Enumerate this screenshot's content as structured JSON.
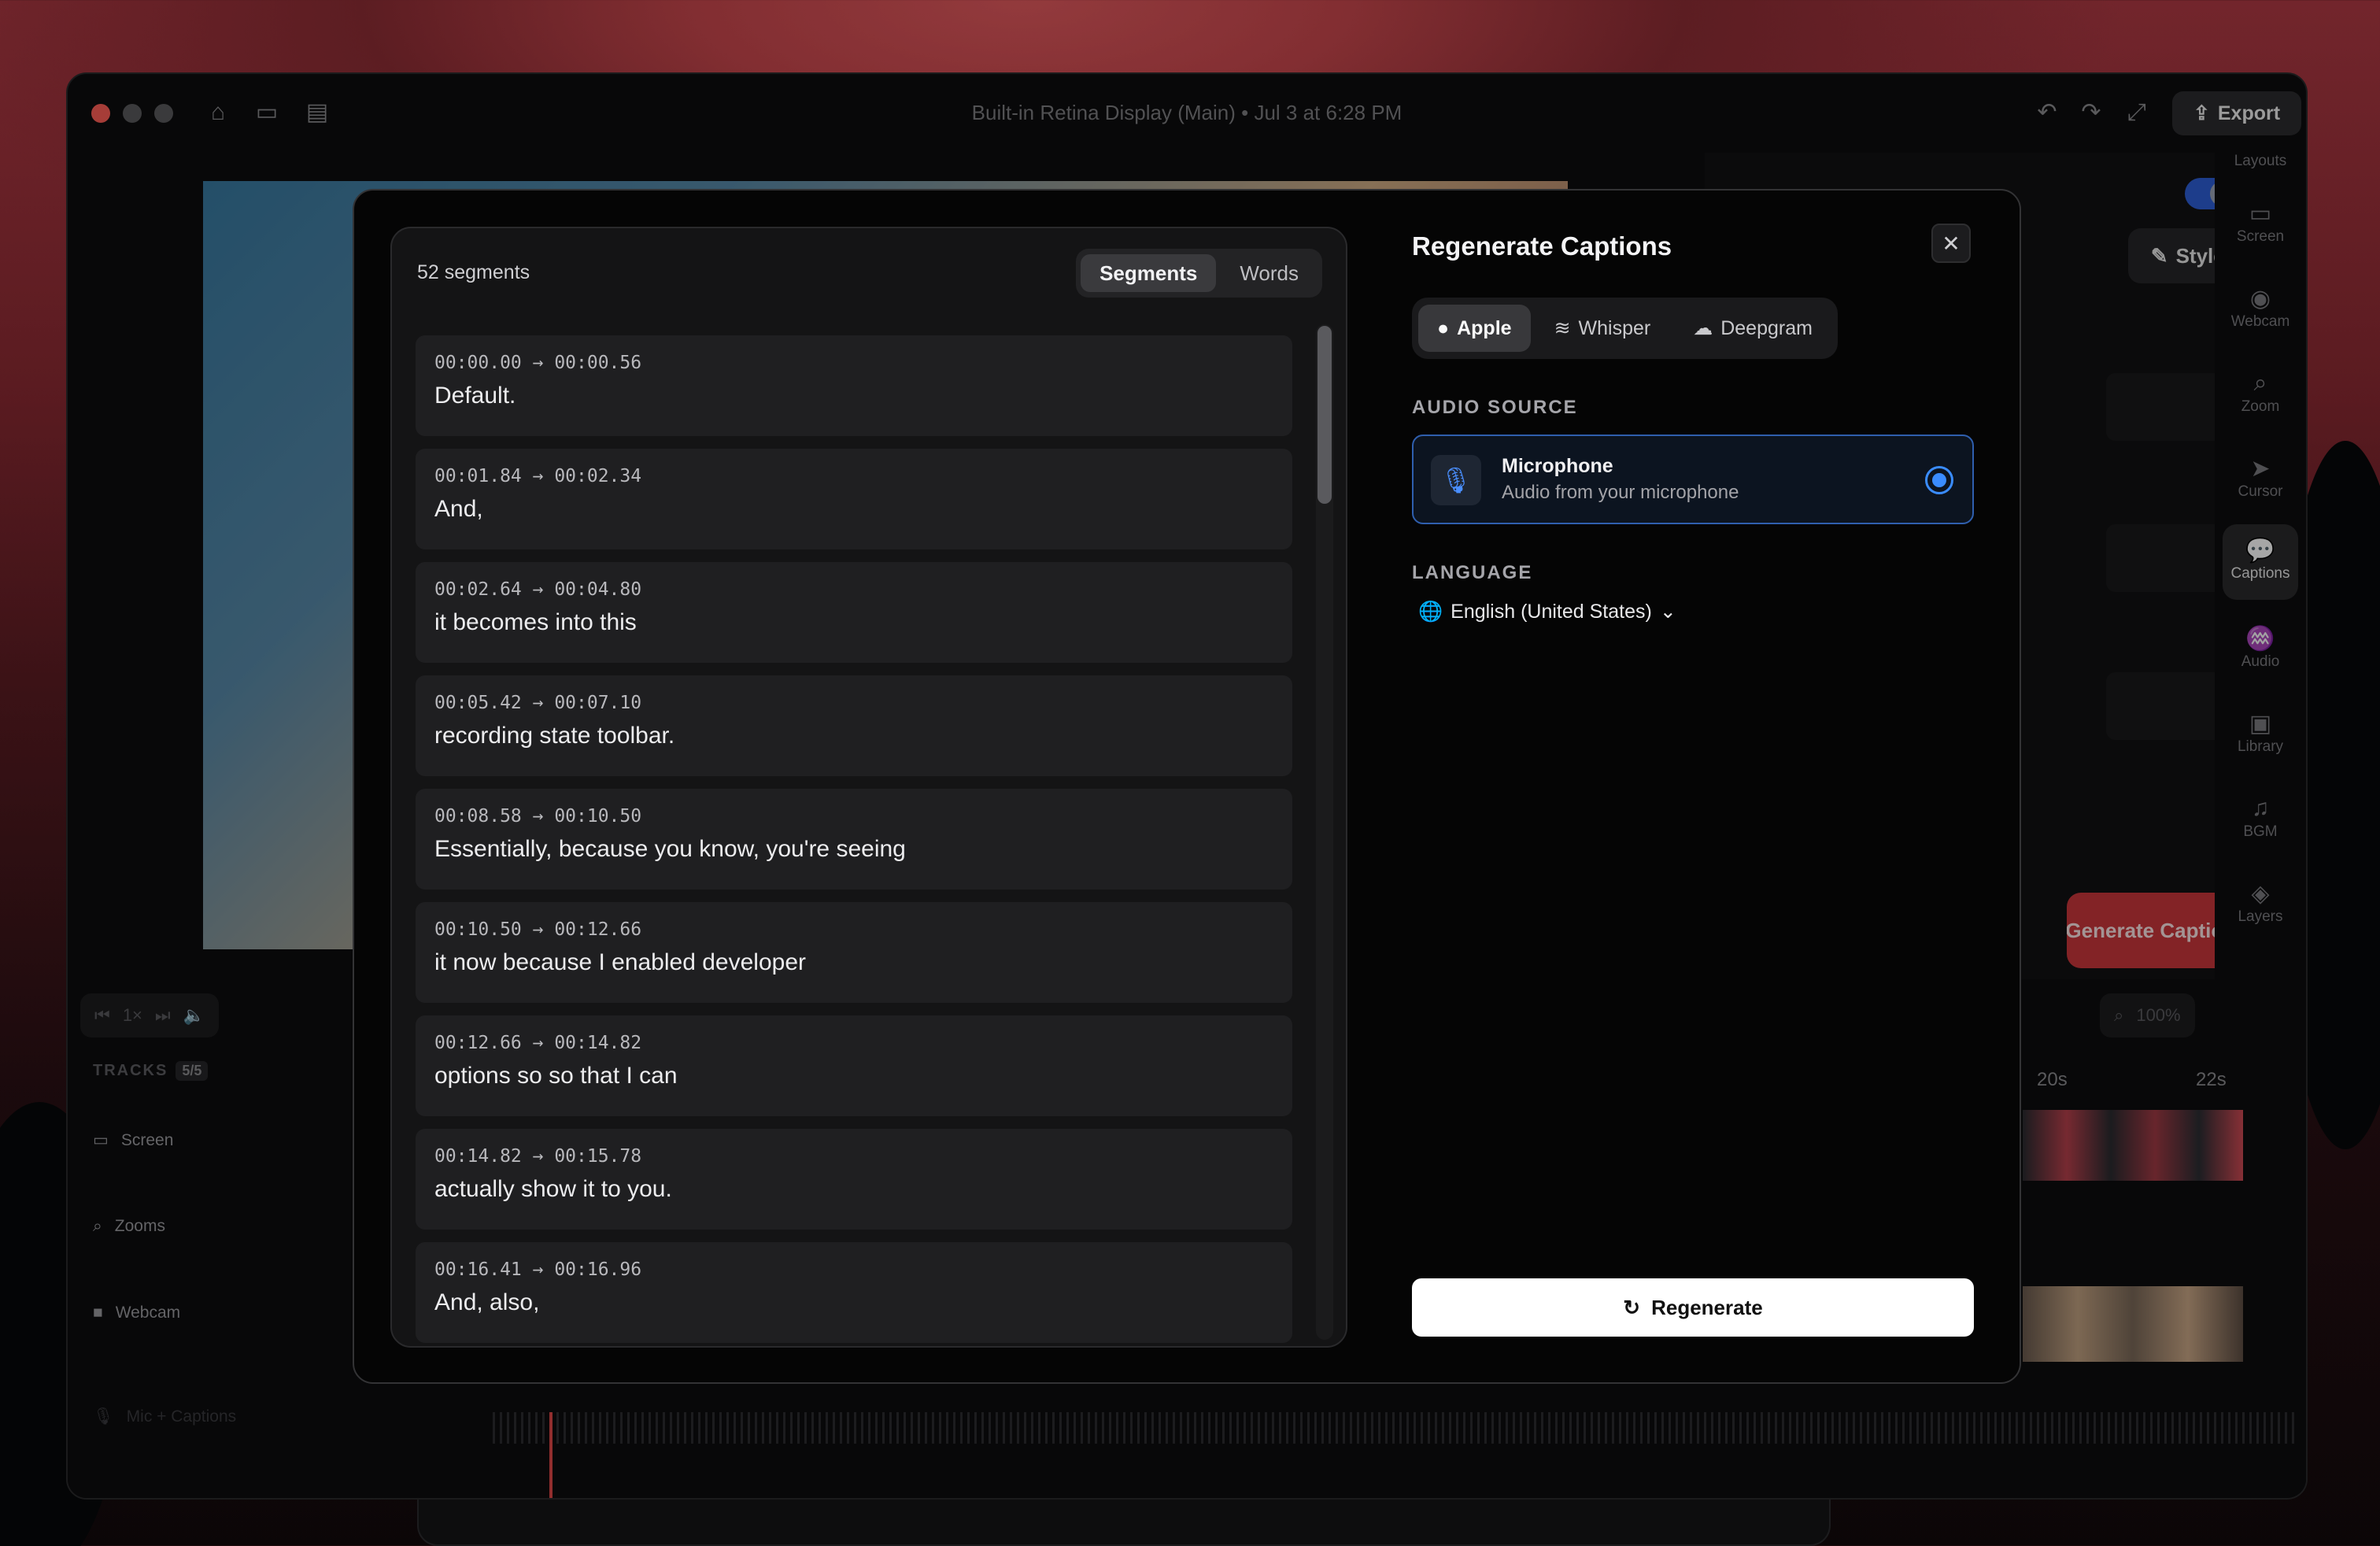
{
  "window": {
    "title": "Built-in Retina Display (Main) • Jul 3 at 6:28 PM",
    "export_label": "Export",
    "icons": [
      "home-icon",
      "folder-icon",
      "window-icon",
      "undo-icon",
      "redo-icon",
      "expand-icon",
      "share-icon"
    ]
  },
  "rail": {
    "header": "Layouts",
    "items": [
      {
        "label": "Screen",
        "icon": "screen-icon"
      },
      {
        "label": "Webcam",
        "icon": "webcam-icon"
      },
      {
        "label": "Zoom",
        "icon": "zoom-icon"
      },
      {
        "label": "Cursor",
        "icon": "cursor-icon"
      },
      {
        "label": "Captions",
        "icon": "captions-icon",
        "active": true
      },
      {
        "label": "Audio",
        "icon": "audio-icon"
      },
      {
        "label": "Library",
        "icon": "library-icon"
      },
      {
        "label": "BGM",
        "icon": "music-icon"
      },
      {
        "label": "Layers",
        "icon": "layers-icon"
      }
    ]
  },
  "right_panel": {
    "styles_label": "Styles",
    "generate_label": "Generate Captions"
  },
  "timeline": {
    "speed": "1×",
    "zoom_level": "100%",
    "tracks_label": "TRACKS",
    "tracks_count": "5/5",
    "tracks": [
      {
        "label": "Screen",
        "icon": "screen-icon"
      },
      {
        "label": "Zooms",
        "icon": "zoom-icon"
      },
      {
        "label": "Webcam",
        "icon": "webcam-icon"
      },
      {
        "label": "Mic + Captions",
        "icon": "mic-icon"
      }
    ],
    "ruler": [
      "20s",
      "22s"
    ]
  },
  "segments_panel": {
    "count_label": "52 segments",
    "tabs": [
      "Segments",
      "Words"
    ],
    "active_tab": "Segments",
    "segments": [
      {
        "time": "00:00.00 → 00:00.56",
        "text": "Default."
      },
      {
        "time": "00:01.84 → 00:02.34",
        "text": "And,"
      },
      {
        "time": "00:02.64 → 00:04.80",
        "text": "it becomes into this"
      },
      {
        "time": "00:05.42 → 00:07.10",
        "text": "recording state toolbar."
      },
      {
        "time": "00:08.58 → 00:10.50",
        "text": "Essentially, because you know, you're seeing"
      },
      {
        "time": "00:10.50 → 00:12.66",
        "text": "it now because I enabled developer"
      },
      {
        "time": "00:12.66 → 00:14.82",
        "text": "options so so that I can"
      },
      {
        "time": "00:14.82 → 00:15.78",
        "text": "actually show it to you."
      },
      {
        "time": "00:16.41 → 00:16.96",
        "text": "And, also,"
      }
    ]
  },
  "regenerate": {
    "title": "Regenerate Captions",
    "close_icon": "close-icon",
    "engines": [
      {
        "label": "Apple",
        "icon": "apple-icon",
        "active": true
      },
      {
        "label": "Whisper",
        "icon": "waveform-icon"
      },
      {
        "label": "Deepgram",
        "icon": "cloud-icon"
      }
    ],
    "audio_source_label": "AUDIO SOURCE",
    "source": {
      "name": "Microphone",
      "description": "Audio from your microphone",
      "selected": true
    },
    "language_label": "LANGUAGE",
    "language_value": "English (United States)",
    "regenerate_label": "Regenerate"
  },
  "colors": {
    "accent": "#3a8cff",
    "danger": "#c9363b",
    "modal_bg": "#050505"
  }
}
